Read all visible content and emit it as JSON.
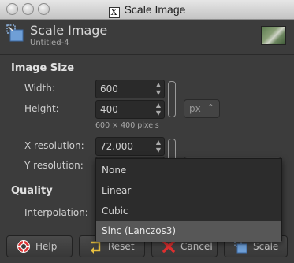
{
  "window": {
    "title": "Scale Image"
  },
  "header": {
    "title": "Scale Image",
    "subtitle": "Untitled-4"
  },
  "image_size": {
    "section": "Image Size",
    "width_label": "Width:",
    "width_value": "600",
    "height_label": "Height:",
    "height_value": "400",
    "size_info": "600 × 400 pixels",
    "unit": "px",
    "xres_label": "X resolution:",
    "xres_value": "72.000",
    "yres_label": "Y resolution:"
  },
  "quality": {
    "section": "Quality",
    "interp_label": "Interpolation:",
    "options": [
      "None",
      "Linear",
      "Cubic",
      "Sinc (Lanczos3)"
    ],
    "selected": "Sinc (Lanczos3)"
  },
  "buttons": {
    "help": "Help",
    "reset": "Reset",
    "cancel": "Cancel",
    "scale": "Scale"
  },
  "colors": {
    "background": "#3c3c3c",
    "dropdown_selected": "#575757"
  }
}
